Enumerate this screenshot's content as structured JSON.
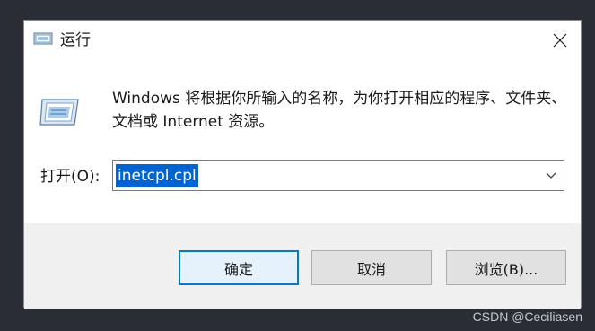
{
  "window": {
    "title": "运行",
    "description": "Windows 将根据你所输入的名称，为你打开相应的程序、文件夹、文档或 Internet 资源。"
  },
  "form": {
    "open_label": "打开(O):",
    "open_value": "inetcpl.cpl"
  },
  "buttons": {
    "ok": "确定",
    "cancel": "取消",
    "browse": "浏览(B)..."
  },
  "watermark": "CSDN @Ceciliasen",
  "icons": {
    "title": "run-icon",
    "main": "run-icon",
    "close": "close-icon",
    "dropdown": "chevron-down-icon"
  },
  "colors": {
    "selection": "#0063d6",
    "primary_border": "#0078d7"
  }
}
